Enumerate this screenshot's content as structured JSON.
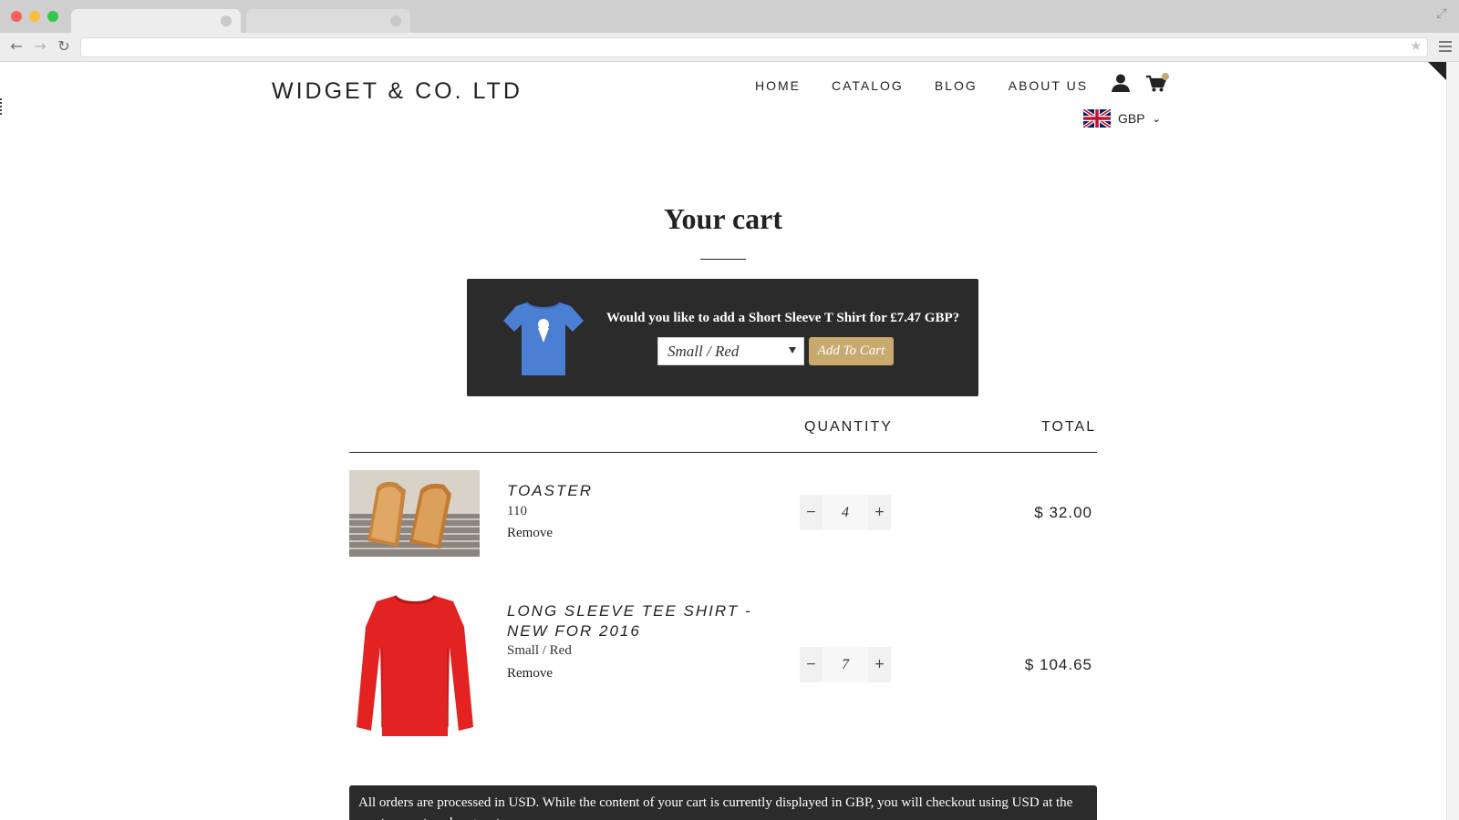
{
  "browser": {
    "back_icon": "arrow-left",
    "forward_icon": "arrow-right",
    "reload_icon": "reload",
    "star_icon": "star",
    "menu_icon": "hamburger"
  },
  "site": {
    "logo": "WIDGET & CO. LTD",
    "nav": [
      "HOME",
      "CATALOG",
      "BLOG",
      "ABOUT US"
    ],
    "currency": "GBP",
    "accent_color": "#c8a96e",
    "dark_color": "#2b2b2b"
  },
  "cart": {
    "title": "Your cart",
    "upsell": {
      "text": "Would you like to add a Short Sleeve T Shirt for £7.47 GBP?",
      "selected_variant": "Small / Red",
      "button_label": "Add To Cart"
    },
    "headers": {
      "quantity": "QUANTITY",
      "total": "TOTAL"
    },
    "items": [
      {
        "name": "TOASTER",
        "variant": "110",
        "remove_label": "Remove",
        "quantity": "4",
        "total": "$ 32.00"
      },
      {
        "name": "LONG SLEEVE TEE SHIRT - NEW FOR 2016",
        "variant": "Small / Red",
        "remove_label": "Remove",
        "quantity": "7",
        "total": "$ 104.65"
      }
    ],
    "notice": "All orders are processed in USD. While the content of your cart is currently displayed in GBP, you will checkout using USD at the most current exchange rate."
  }
}
